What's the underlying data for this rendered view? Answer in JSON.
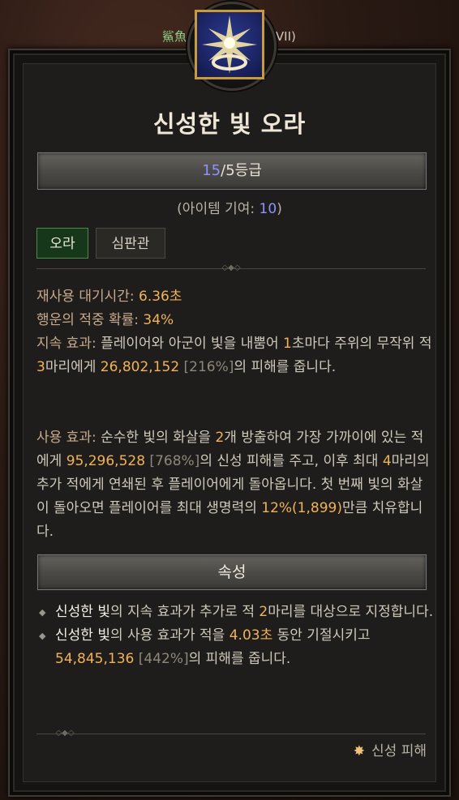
{
  "background": {
    "top_text_left": "鯊魚",
    "top_text_right": "244) (VII)"
  },
  "skill": {
    "icon": "holy-light-aura-icon",
    "name": "신성한 빛 오라",
    "rank_current": "15",
    "rank_suffix": "/5등급",
    "contribution_prefix": "(아이템 기여: ",
    "contribution_value": "10",
    "contribution_suffix": ")"
  },
  "tags": [
    "오라",
    "심판관"
  ],
  "stats": {
    "cooldown_label": "재사용 대기시간: ",
    "cooldown_value": "6.36초",
    "luck_label": "행운의 적중 확률: ",
    "luck_value": "34%"
  },
  "passive": {
    "label": "지속 효과: ",
    "t1": "플레이어와 아군이 빛을 내뿜어 ",
    "interval": "1",
    "t2": "초마다 주위의 무작위 적 ",
    "targets": "3",
    "t3": "마리에게 ",
    "damage": "26,802,152",
    "percent": " [216%]",
    "t4": "의 피해를 줍니다."
  },
  "active": {
    "label": "사용 효과: ",
    "t1": "순수한 빛의 화살을 ",
    "arrows": "2",
    "t2": "개 방출하여 가장 가까이에 있는 적에게 ",
    "damage": "95,296,528",
    "percent": " [768%]",
    "t3": "의 신성 피해를 주고, 이후 최대 ",
    "chain": "4",
    "t4": "마리의 추가 적에게 연쇄된 후 플레이어에게 돌아옵니다. 첫 번째 빛의 화살이 돌아오면 플레이어를 최대 생명력의 ",
    "heal": "12%(1,899)",
    "t5": "만큼 치유합니다."
  },
  "attributes_header": "속성",
  "attributes": [
    {
      "name": "신성한 빛",
      "t1": "의 지속 효과가 추가로 적 ",
      "value": "2",
      "t2": "마리를 대상으로 지정합니다."
    },
    {
      "name": "신성한 빛",
      "t1": "의 사용 효과가 적을 ",
      "value": "4.03초",
      "t2": " 동안 기절시키고 ",
      "damage": "54,845,136",
      "percent": " [442%]",
      "t3": "의 피해를 줍니다."
    }
  ],
  "damage_type": "신성 피해",
  "colors": {
    "orange": "#f0b25a",
    "blue": "#8c92ff",
    "gray": "#8d877c",
    "green_tag": "#17371a"
  }
}
